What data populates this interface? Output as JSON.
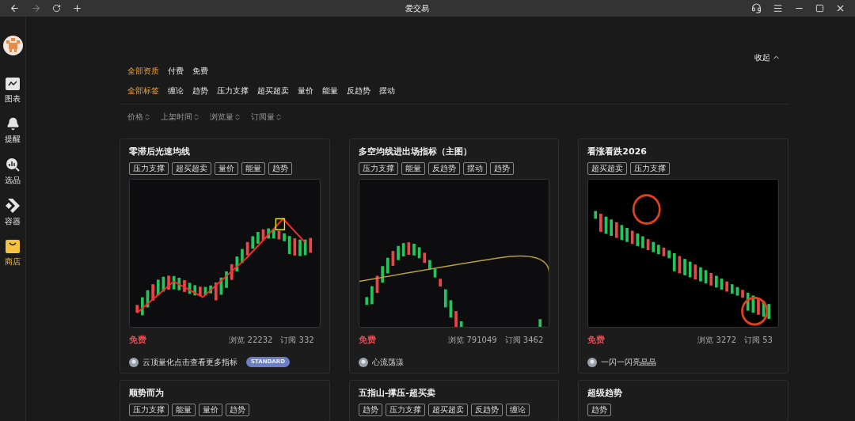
{
  "window": {
    "title": "爱交易"
  },
  "sidebar": {
    "items": [
      {
        "label": "图表",
        "selected": false
      },
      {
        "label": "提醒",
        "selected": false
      },
      {
        "label": "选品",
        "selected": false
      },
      {
        "label": "容器",
        "selected": false
      },
      {
        "label": "商店",
        "selected": true
      }
    ]
  },
  "filters": {
    "collapse": "收起",
    "qualification": [
      {
        "label": "全部资质",
        "selected": true
      },
      {
        "label": "付费",
        "selected": false
      },
      {
        "label": "免费",
        "selected": false
      }
    ],
    "tags": [
      {
        "label": "全部标签",
        "selected": true
      },
      {
        "label": "缠论",
        "selected": false
      },
      {
        "label": "趋势",
        "selected": false
      },
      {
        "label": "压力支撑",
        "selected": false
      },
      {
        "label": "超买超卖",
        "selected": false
      },
      {
        "label": "量价",
        "selected": false
      },
      {
        "label": "能量",
        "selected": false
      },
      {
        "label": "反趋势",
        "selected": false
      },
      {
        "label": "摆动",
        "selected": false
      }
    ],
    "sort": [
      "价格",
      "上架时间",
      "浏览量",
      "订阅量"
    ]
  },
  "cards": [
    {
      "title": "零滞后光速均线",
      "tags": [
        "压力支撑",
        "超买超卖",
        "量价",
        "能量",
        "趋势"
      ],
      "picture": {
        "kind": "picture"
      },
      "price": "免费",
      "views": "浏览 22232",
      "subscriptions": "订阅 332",
      "author": "云顶量化点击查看更多指标",
      "badge": "STANDARD"
    },
    {
      "title": "多空均线进出场指标（主图）",
      "tags": [
        "压力支撑",
        "能量",
        "反趋势",
        "摆动",
        "趋势"
      ],
      "picture": {
        "kind": "picture"
      },
      "price": "免费",
      "views": "浏览 791049",
      "subscriptions": "订阅 3462",
      "author": "心流荡漾"
    },
    {
      "title": "看涨看跌2026",
      "tags": [
        "超买超卖",
        "压力支撑"
      ],
      "picture": {
        "kind": "picture"
      },
      "price": "免费",
      "views": "浏览 3272",
      "subscriptions": "订阅 53",
      "author": "一闪一闪亮晶晶"
    },
    {
      "title": "顺势而为",
      "tags": [
        "压力支撑",
        "能量",
        "量价",
        "趋势"
      ]
    },
    {
      "title": "五指山-撑压-超买卖",
      "tags": [
        "趋势",
        "压力支撑",
        "超买超卖",
        "反趋势",
        "缠论"
      ]
    },
    {
      "title": "超级趋势",
      "tags": [
        "趋势"
      ]
    }
  ]
}
